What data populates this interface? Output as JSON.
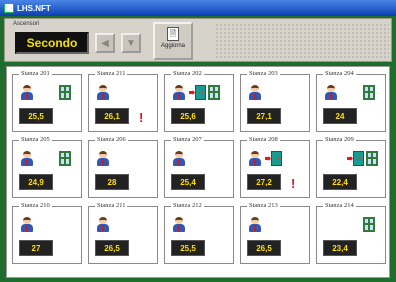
{
  "window": {
    "title": "LHS.NFT"
  },
  "toolbar": {
    "label": "Ascensori",
    "mode": "Secondo",
    "prev_icon": "chevron-left-icon",
    "next_icon": "chevron-down-icon",
    "update_label": "Aggiorna",
    "update_icon": "document-icon"
  },
  "colors": {
    "background": "#1f6d2d",
    "lcd_text": "#f5e200",
    "temp_text": "#ffe000",
    "alert": "#d81212",
    "window_frame": "#2f7a3c",
    "door": "#1a9b92"
  },
  "rooms": [
    {
      "name": "Stanza 201",
      "temp": "25,5",
      "person": true,
      "window": true,
      "door": false,
      "alert": false
    },
    {
      "name": "Stanza 211",
      "temp": "26,1",
      "person": true,
      "window": false,
      "door": false,
      "alert": true
    },
    {
      "name": "Stanza 202",
      "temp": "25,6",
      "person": true,
      "window": true,
      "door": true,
      "alert": false
    },
    {
      "name": "Stanza 203",
      "temp": "27,1",
      "person": true,
      "window": false,
      "door": false,
      "alert": false
    },
    {
      "name": "Stanza 204",
      "temp": "24",
      "person": true,
      "window": true,
      "door": false,
      "alert": false
    },
    {
      "name": "Stanza 205",
      "temp": "24,9",
      "person": true,
      "window": true,
      "door": false,
      "alert": false
    },
    {
      "name": "Stanza 206",
      "temp": "28",
      "person": true,
      "window": false,
      "door": false,
      "alert": false
    },
    {
      "name": "Stanza 207",
      "temp": "25,4",
      "person": true,
      "window": false,
      "door": false,
      "alert": false
    },
    {
      "name": "Stanza 208",
      "temp": "27,2",
      "person": true,
      "window": false,
      "door": true,
      "alert": true
    },
    {
      "name": "Stanza 209",
      "temp": "22,4",
      "person": false,
      "window": true,
      "door": true,
      "alert": false
    },
    {
      "name": "Stanza 210",
      "temp": "27",
      "person": true,
      "window": false,
      "door": false,
      "alert": false
    },
    {
      "name": "Stanza 211",
      "temp": "26,5",
      "person": true,
      "window": false,
      "door": false,
      "alert": false
    },
    {
      "name": "Stanza 212",
      "temp": "25,5",
      "person": true,
      "window": false,
      "door": false,
      "alert": false
    },
    {
      "name": "Stanza 213",
      "temp": "26,5",
      "person": true,
      "window": false,
      "door": false,
      "alert": false
    },
    {
      "name": "Stanza 214",
      "temp": "23,4",
      "person": false,
      "window": true,
      "door": false,
      "alert": false
    }
  ]
}
